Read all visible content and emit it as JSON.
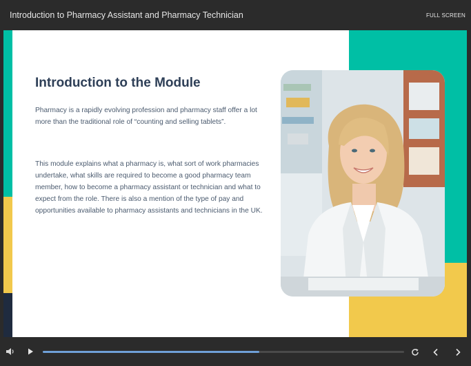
{
  "header": {
    "title": "Introduction to Pharmacy Assistant and Pharmacy Technician",
    "fullscreen_label": "FULL SCREEN"
  },
  "slide": {
    "heading": "Introduction to the Module",
    "paragraphs": [
      "Pharmacy is a rapidly evolving profession and pharmacy staff offer a lot more than the traditional role of “counting and selling tablets”.",
      "This module explains what a pharmacy is, what sort of work pharmacies undertake, what skills are required to become a good pharmacy team member, how to become a pharmacy assistant or technician and what to expect from the role. There is also a mention of the type of pay and opportunities available to pharmacy assistants and technicians in the UK."
    ],
    "colors": {
      "accent_teal": "#00bfa5",
      "accent_yellow": "#f2c94c",
      "accent_navy": "#1f2b3f",
      "heading": "#2e3f57"
    },
    "photo_subject": "smiling pharmacist in white coat"
  },
  "player": {
    "progress": 0.6,
    "progress_color": "#6fa0d8",
    "icons": [
      "volume-icon",
      "play-icon",
      "replay-icon",
      "previous-icon",
      "next-icon"
    ]
  }
}
